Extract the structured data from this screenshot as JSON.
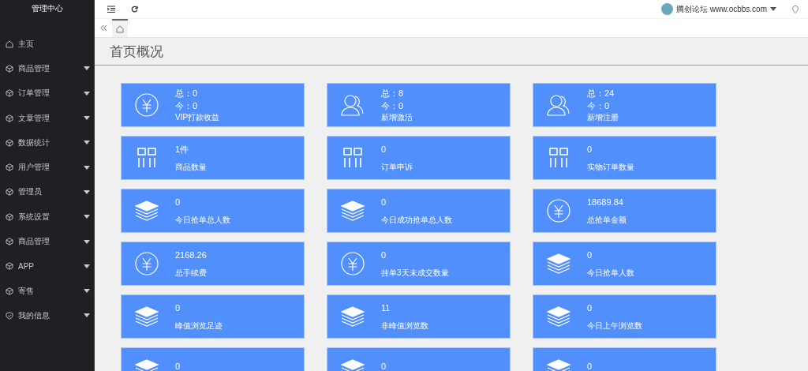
{
  "sidebar": {
    "title": "管理中心",
    "items": [
      {
        "label": "主页",
        "kind": "home"
      },
      {
        "label": "商品管理",
        "kind": "section"
      },
      {
        "label": "订单管理",
        "kind": "section"
      },
      {
        "label": "文章管理",
        "kind": "section"
      },
      {
        "label": "数据统计",
        "kind": "section"
      },
      {
        "label": "用户管理",
        "kind": "section"
      },
      {
        "label": "管理员",
        "kind": "section"
      },
      {
        "label": "系统设置",
        "kind": "section"
      },
      {
        "label": "商品管理",
        "kind": "section"
      },
      {
        "label": "APP",
        "kind": "section"
      },
      {
        "label": "寄售",
        "kind": "section"
      },
      {
        "label": "我的信息",
        "kind": "profile"
      }
    ]
  },
  "header": {
    "user": "腾创论坛 www.ocbbs.com"
  },
  "tabs": [
    {
      "kind": "home",
      "selected": true
    }
  ],
  "page_title": "首页概况",
  "cards": [
    {
      "kind": "money",
      "lines": [
        "总：0",
        "今：0"
      ],
      "label": "VIP打款收益"
    },
    {
      "kind": "users",
      "lines": [
        "总：8",
        "今：0"
      ],
      "label": "新增激活"
    },
    {
      "kind": "users",
      "lines": [
        "总：24",
        "今：0"
      ],
      "label": "新增注册"
    },
    {
      "kind": "items",
      "lines": [
        "1件"
      ],
      "label": "商品数量"
    },
    {
      "kind": "items",
      "lines": [
        "0"
      ],
      "label": "订单申诉"
    },
    {
      "kind": "items",
      "lines": [
        "0"
      ],
      "label": "实物订单数量"
    },
    {
      "kind": "layers",
      "lines": [
        "0"
      ],
      "label": "今日抢单总人数"
    },
    {
      "kind": "layers",
      "lines": [
        "0"
      ],
      "label": "今日成功抢单总人数"
    },
    {
      "kind": "money",
      "lines": [
        "18689.84"
      ],
      "label": "总抢单金额"
    },
    {
      "kind": "money",
      "lines": [
        "2168.26"
      ],
      "label": "总手续费"
    },
    {
      "kind": "money",
      "lines": [
        "0"
      ],
      "label": "挂单3天未成交数量"
    },
    {
      "kind": "layers",
      "lines": [
        "0"
      ],
      "label": "今日抢单人数"
    },
    {
      "kind": "layers",
      "lines": [
        "0"
      ],
      "label": "峰值浏览足迹"
    },
    {
      "kind": "layers",
      "lines": [
        "11"
      ],
      "label": "非峰值浏览数"
    },
    {
      "kind": "layers",
      "lines": [
        "0"
      ],
      "label": "今日上午浏览数"
    },
    {
      "kind": "layers",
      "lines": [
        "0"
      ]
    },
    {
      "kind": "layers",
      "lines": [
        "0"
      ]
    },
    {
      "kind": "layers",
      "lines": [
        "0"
      ]
    }
  ]
}
